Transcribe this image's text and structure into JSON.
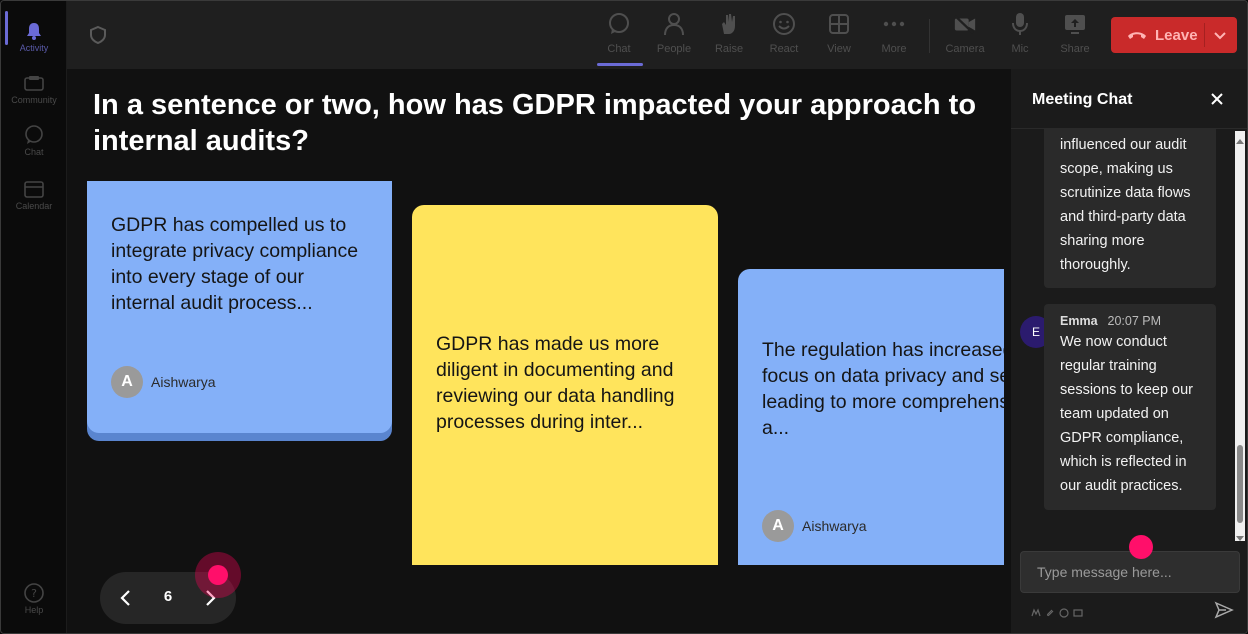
{
  "rail": {
    "items": [
      {
        "label": "Activity",
        "icon": "bell-icon",
        "active": true
      },
      {
        "label": "Community",
        "icon": "community-icon",
        "active": false
      },
      {
        "label": "Chat",
        "icon": "chat-bubble-icon",
        "active": false
      },
      {
        "label": "Calendar",
        "icon": "calendar-icon",
        "active": false
      },
      {
        "label": "Help",
        "icon": "help-icon",
        "active": false
      }
    ]
  },
  "toolbar": {
    "items": [
      {
        "label": "Chat",
        "icon": "chat-icon",
        "active": true
      },
      {
        "label": "People",
        "icon": "people-icon"
      },
      {
        "label": "Raise",
        "icon": "raise-hand-icon"
      },
      {
        "label": "React",
        "icon": "emoji-icon"
      },
      {
        "label": "View",
        "icon": "grid-view-icon"
      },
      {
        "label": "More",
        "icon": "more-dots-icon"
      },
      {
        "label": "Camera",
        "icon": "camera-off-icon"
      },
      {
        "label": "Mic",
        "icon": "mic-icon"
      },
      {
        "label": "Share",
        "icon": "share-screen-icon"
      }
    ],
    "leave_label": "Leave"
  },
  "stage": {
    "question": "In a sentence or two, how has GDPR impacted your approach to internal audits?",
    "cards": [
      {
        "text": "GDPR has compelled us to integrate privacy compliance into every stage of our internal audit process...",
        "author": "Aishwarya",
        "initial": "A",
        "color": "#84b0f8"
      },
      {
        "text": "GDPR has made us more diligent in documenting and reviewing our data handling processes during inter...",
        "color": "#ffe45c"
      },
      {
        "text": "The regulation has increased our focus on data privacy and security, leading to more comprehensive a...",
        "author": "Aishwarya",
        "initial": "A",
        "color": "#84b0f8"
      }
    ],
    "pager": {
      "page": "6"
    }
  },
  "chat": {
    "title": "Meeting Chat",
    "messages": [
      {
        "text": "influenced our audit scope, making us scrutinize data flows and third-party data sharing more thoroughly."
      },
      {
        "author": "Emma",
        "initial": "E",
        "time": "20:07 PM",
        "text": "We now conduct regular training sessions to keep our team updated on GDPR compliance, which is reflected in our audit practices."
      }
    ],
    "input_placeholder": "Type message here..."
  },
  "colors": {
    "accent": "#6b6bd6",
    "leave": "#c92a2a",
    "cursor": "#ff0f6a"
  }
}
